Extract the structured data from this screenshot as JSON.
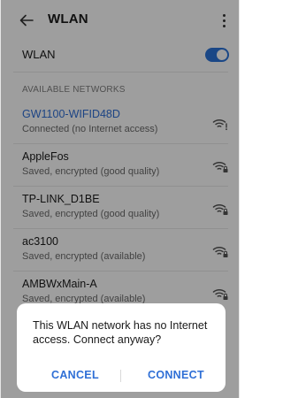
{
  "header": {
    "title": "WLAN",
    "back_icon": "arrow-left-icon",
    "more_icon": "more-vertical-icon"
  },
  "wlan_toggle": {
    "label": "WLAN",
    "state": "on",
    "accent_color": "#2b73d9"
  },
  "section_title": "AVAILABLE NETWORKS",
  "networks": [
    {
      "name": "GW1100-WIFID48D",
      "status": "Connected (no Internet access)",
      "connected": true,
      "icon": "wifi-no-internet-icon"
    },
    {
      "name": "AppleFos",
      "status": "Saved, encrypted (good quality)",
      "connected": false,
      "icon": "wifi-locked-icon"
    },
    {
      "name": "TP-LINK_D1BE",
      "status": "Saved, encrypted (good quality)",
      "connected": false,
      "icon": "wifi-locked-icon"
    },
    {
      "name": "ac3100",
      "status": "Saved, encrypted (available)",
      "connected": false,
      "icon": "wifi-locked-icon"
    },
    {
      "name": "AMBWxMain-A",
      "status": "Saved, encrypted (available)",
      "connected": false,
      "icon": "wifi-locked-icon"
    }
  ],
  "dialog": {
    "message": "This WLAN network has no Internet access. Connect anyway?",
    "cancel_label": "CANCEL",
    "connect_label": "CONNECT"
  },
  "colors": {
    "link_blue": "#2f6fd6",
    "scrim": "rgba(0,0,0,0.38)"
  }
}
